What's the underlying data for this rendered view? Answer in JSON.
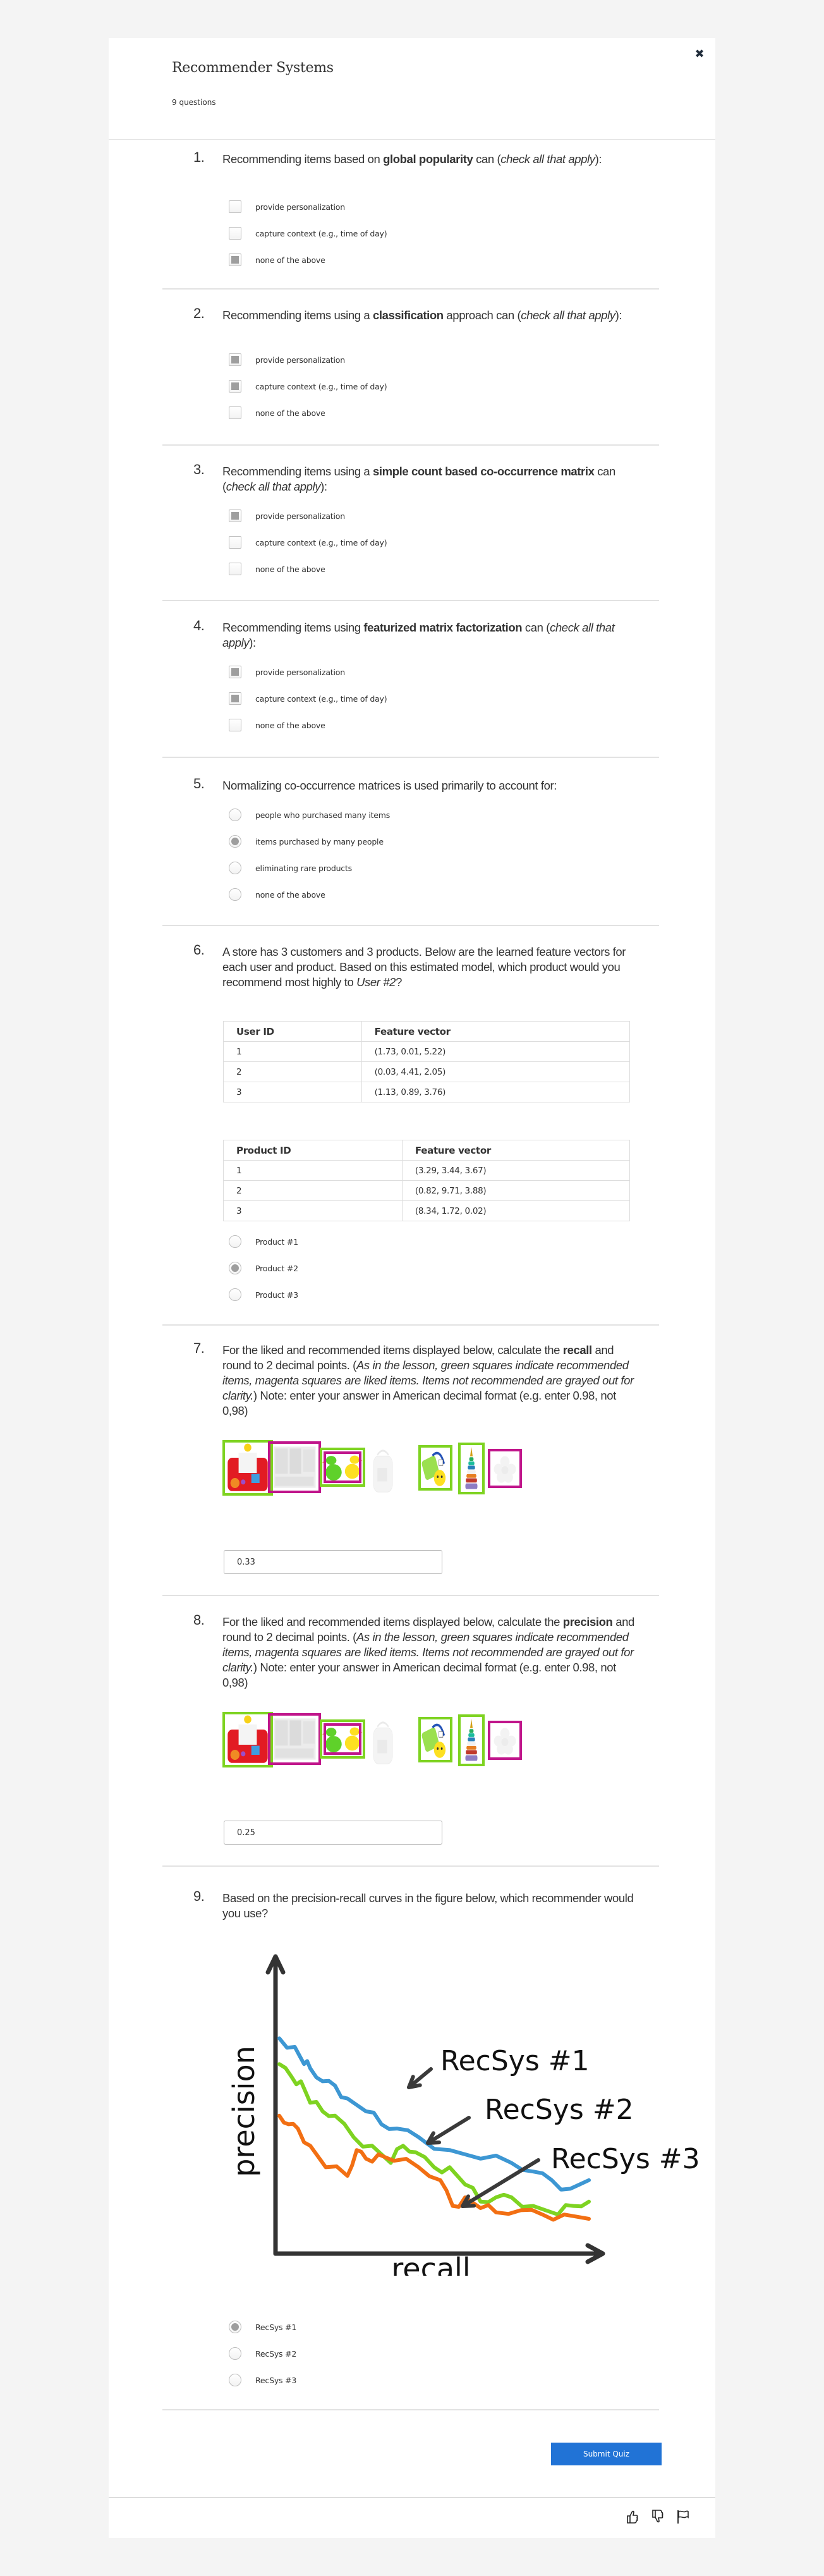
{
  "header": {
    "title": "Recommender Systems",
    "subtitle": "9 questions",
    "close_icon": "close-icon"
  },
  "questions": [
    {
      "number": "1.",
      "type": "checkbox",
      "text_parts": [
        {
          "t": "Recommending items based on "
        },
        {
          "t": "global popularity",
          "b": true
        },
        {
          "t": " can ("
        },
        {
          "t": "check all that apply",
          "i": true
        },
        {
          "t": "):"
        }
      ],
      "options": [
        {
          "label": "provide personalization",
          "checked": false
        },
        {
          "label": "capture context (e.g., time of day)",
          "checked": false
        },
        {
          "label": "none of the above",
          "checked": true
        }
      ]
    },
    {
      "number": "2.",
      "type": "checkbox",
      "text_parts": [
        {
          "t": "Recommending items using a "
        },
        {
          "t": "classification",
          "b": true
        },
        {
          "t": " approach can ("
        },
        {
          "t": "check all that apply",
          "i": true
        },
        {
          "t": "):"
        }
      ],
      "options": [
        {
          "label": "provide personalization",
          "checked": true
        },
        {
          "label": "capture context (e.g., time of day)",
          "checked": true
        },
        {
          "label": "none of the above",
          "checked": false
        }
      ]
    },
    {
      "number": "3.",
      "type": "checkbox",
      "text_parts": [
        {
          "t": "Recommending items using a "
        },
        {
          "t": "simple count based co-occurrence matrix",
          "b": true
        },
        {
          "t": " can ("
        },
        {
          "t": "check all that apply",
          "i": true
        },
        {
          "t": "):"
        }
      ],
      "options": [
        {
          "label": "provide personalization",
          "checked": true
        },
        {
          "label": "capture context (e.g., time of day)",
          "checked": false
        },
        {
          "label": "none of the above",
          "checked": false
        }
      ]
    },
    {
      "number": "4.",
      "type": "checkbox",
      "text_parts": [
        {
          "t": "Recommending items using "
        },
        {
          "t": "featurized matrix factorization",
          "b": true
        },
        {
          "t": " can ("
        },
        {
          "t": "check all that apply",
          "i": true
        },
        {
          "t": "):"
        }
      ],
      "options": [
        {
          "label": "provide personalization",
          "checked": true
        },
        {
          "label": "capture context (e.g., time of day)",
          "checked": true
        },
        {
          "label": "none of the above",
          "checked": false
        }
      ]
    },
    {
      "number": "5.",
      "type": "radio",
      "text_parts": [
        {
          "t": "Normalizing co-occurrence matrices is used primarily to account for:"
        }
      ],
      "options": [
        {
          "label": "people who purchased many items",
          "checked": false
        },
        {
          "label": "items purchased by many people",
          "checked": true
        },
        {
          "label": "eliminating rare products",
          "checked": false
        },
        {
          "label": "none of the above",
          "checked": false
        }
      ]
    },
    {
      "number": "6.",
      "type": "radio",
      "text_parts": [
        {
          "t": "A store has 3 customers and 3 products. Below are the learned feature vectors for each user and product. Based on this estimated model, which product would you recommend most highly to "
        },
        {
          "t": "User #2",
          "i": true
        },
        {
          "t": "?"
        }
      ],
      "user_table": {
        "headers": [
          "User ID",
          "Feature vector"
        ],
        "rows": [
          [
            "1",
            "(1.73, 0.01, 5.22)"
          ],
          [
            "2",
            "(0.03, 4.41, 2.05)"
          ],
          [
            "3",
            "(1.13, 0.89, 3.76)"
          ]
        ]
      },
      "product_table": {
        "headers": [
          "Product ID",
          "Feature vector"
        ],
        "rows": [
          [
            "1",
            "(3.29, 3.44, 3.67)"
          ],
          [
            "2",
            "(0.82, 9.71, 3.88)"
          ],
          [
            "3",
            "(8.34, 1.72, 0.02)"
          ]
        ]
      },
      "options": [
        {
          "label": "Product #1",
          "checked": false
        },
        {
          "label": "Product #2",
          "checked": true
        },
        {
          "label": "Product #3",
          "checked": false
        }
      ]
    },
    {
      "number": "7.",
      "type": "text",
      "text_parts": [
        {
          "t": "For the liked and recommended items displayed below, calculate the "
        },
        {
          "t": "recall",
          "b": true
        },
        {
          "t": " and round to 2 decimal points. ("
        },
        {
          "t": "As in the lesson, green squares indicate recommended items, magenta squares are liked items. Items not recommended are grayed out for clarity.",
          "i": true
        },
        {
          "t": ") Note: enter your answer in American decimal format (e.g. enter 0.98, not 0,98)"
        }
      ],
      "items": [
        {
          "name": "farm-activity-toy",
          "recommended": true,
          "liked": false
        },
        {
          "name": "dr-seuss-books",
          "recommended": false,
          "liked": true
        },
        {
          "name": "rubber-ducks",
          "recommended": true,
          "liked": true
        },
        {
          "name": "baby-photo-book",
          "recommended": false,
          "liked": false
        },
        {
          "name": "caterpillar-toy",
          "recommended": true,
          "liked": false
        },
        {
          "name": "stacking-rings",
          "recommended": true,
          "liked": false
        },
        {
          "name": "flower-teether",
          "recommended": false,
          "liked": true
        }
      ],
      "answer": "0.33"
    },
    {
      "number": "8.",
      "type": "text",
      "text_parts": [
        {
          "t": "For the liked and recommended items displayed below, calculate the "
        },
        {
          "t": "precision",
          "b": true
        },
        {
          "t": " and round to 2 decimal points. ("
        },
        {
          "t": "As in the lesson, green squares indicate recommended items, magenta squares are liked items. Items not recommended are grayed out for clarity.",
          "i": true
        },
        {
          "t": ") Note: enter your answer in American decimal format (e.g. enter 0.98, not 0,98)"
        }
      ],
      "items": [
        {
          "name": "farm-activity-toy",
          "recommended": true,
          "liked": false
        },
        {
          "name": "dr-seuss-books",
          "recommended": false,
          "liked": true
        },
        {
          "name": "rubber-ducks",
          "recommended": true,
          "liked": true
        },
        {
          "name": "baby-photo-book",
          "recommended": false,
          "liked": false
        },
        {
          "name": "caterpillar-toy",
          "recommended": true,
          "liked": false
        },
        {
          "name": "stacking-rings",
          "recommended": true,
          "liked": false
        },
        {
          "name": "flower-teether",
          "recommended": false,
          "liked": true
        }
      ],
      "answer": "0.25"
    },
    {
      "number": "9.",
      "type": "radio",
      "text_parts": [
        {
          "t": "Based on the precision-recall curves in the figure below, which recommender would you use?"
        }
      ],
      "options": [
        {
          "label": "RecSys #1",
          "checked": true
        },
        {
          "label": "RecSys #2",
          "checked": false
        },
        {
          "label": "RecSys #3",
          "checked": false
        }
      ]
    }
  ],
  "chart_data": {
    "type": "line",
    "title": "",
    "xlabel": "recall",
    "ylabel": "precision",
    "xlim": [
      0,
      1
    ],
    "ylim": [
      0,
      1
    ],
    "grid": false,
    "legend": "annotations with arrows, right side",
    "annotations": [
      "RecSys #1",
      "RecSys #2",
      "RecSys #3"
    ],
    "series": [
      {
        "name": "RecSys #1",
        "color": "#3d97d3",
        "x": [
          0.0,
          0.05,
          0.08,
          0.1,
          0.14,
          0.18,
          0.22,
          0.28,
          0.33,
          0.38,
          0.45,
          0.55,
          0.65,
          0.75,
          0.82,
          0.88,
          0.94,
          1.0
        ],
        "y": [
          0.84,
          0.8,
          0.72,
          0.7,
          0.64,
          0.62,
          0.56,
          0.5,
          0.44,
          0.42,
          0.38,
          0.32,
          0.28,
          0.26,
          0.22,
          0.18,
          0.14,
          0.18
        ]
      },
      {
        "name": "RecSys #2",
        "color": "#7ed321",
        "x": [
          0.0,
          0.04,
          0.07,
          0.1,
          0.14,
          0.18,
          0.24,
          0.3,
          0.36,
          0.4,
          0.44,
          0.5,
          0.55,
          0.6,
          0.65,
          0.7,
          0.75,
          0.82,
          0.9,
          0.95,
          1.0
        ],
        "y": [
          0.72,
          0.66,
          0.64,
          0.54,
          0.5,
          0.48,
          0.38,
          0.34,
          0.26,
          0.34,
          0.31,
          0.24,
          0.24,
          0.16,
          0.08,
          0.1,
          0.1,
          0.06,
          0.02,
          0.06,
          0.08
        ]
      },
      {
        "name": "RecSys #3",
        "color": "#f26f13",
        "x": [
          0.0,
          0.03,
          0.06,
          0.1,
          0.15,
          0.22,
          0.25,
          0.28,
          0.32,
          0.37,
          0.45,
          0.52,
          0.56,
          0.6,
          0.65,
          0.7,
          0.78,
          0.85,
          0.92,
          1.0
        ],
        "y": [
          0.48,
          0.44,
          0.42,
          0.34,
          0.24,
          0.2,
          0.32,
          0.28,
          0.3,
          0.27,
          0.24,
          0.18,
          0.06,
          0.1,
          0.05,
          0.03,
          0.04,
          0.02,
          0.02,
          0.0
        ]
      }
    ]
  },
  "submit_label": "Submit Quiz",
  "footer": {
    "icons": [
      "thumbs-up-icon",
      "thumbs-down-icon",
      "flag-icon"
    ]
  }
}
